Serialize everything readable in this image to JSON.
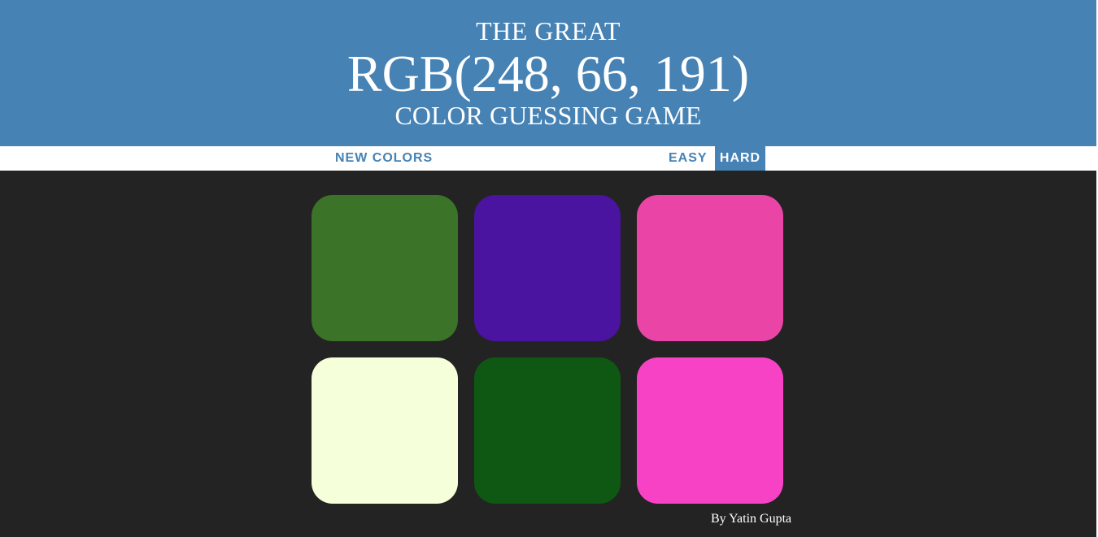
{
  "header": {
    "line_top": "THE GREAT",
    "rgb_display": "RGB(248, 66, 191)",
    "line_bottom": "COLOR GUESSING GAME",
    "background_color": "#4682b4"
  },
  "controls": {
    "new_colors_label": "NEW COLORS",
    "easy_label": "EASY",
    "hard_label": "HARD",
    "selected_mode": "HARD"
  },
  "squares": [
    {
      "color": "#3b7328"
    },
    {
      "color": "#4a13a0"
    },
    {
      "color": "#e944a6"
    },
    {
      "color": "#f5ffd9"
    },
    {
      "color": "#0f5814"
    },
    {
      "color": "#f842c6"
    }
  ],
  "footer": {
    "credit": "By Yatin Gupta"
  },
  "theme": {
    "page_background": "#232323",
    "accent": "#4682b4"
  }
}
